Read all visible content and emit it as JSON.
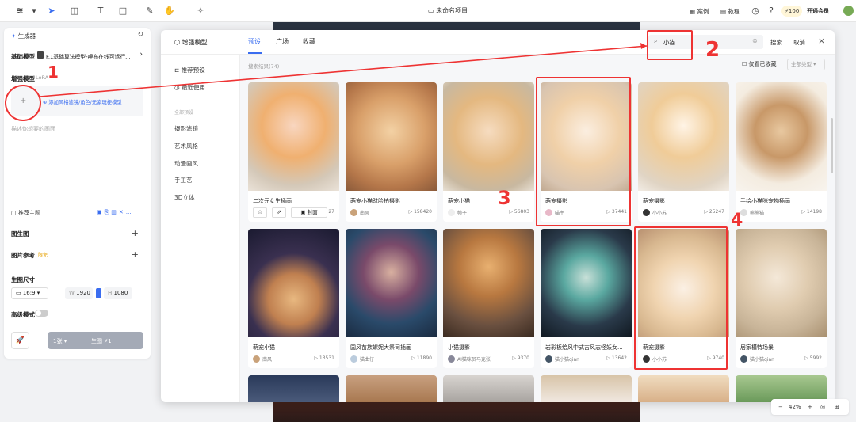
{
  "topbar": {
    "project_title": "未命名项目",
    "right_items": [
      "案例",
      "教程"
    ],
    "credits": "100",
    "member_btn": "开通会员"
  },
  "left_panel": {
    "title": "生成器",
    "base_model_label": "基础模型",
    "base_model_value": "F.1基础算法模型-哩布在线可运行...",
    "enhance_label": "增强模型",
    "enhance_type": "LoRA",
    "add_lora_hint": "添加风格滤镜/角色/元素玩梗模型",
    "prompt_placeholder": "描述你想要的画面",
    "recommend_label": "推荐主题",
    "gen_img_label": "图生图",
    "ref_label": "图片参考",
    "ref_badge": "限免",
    "size_label": "生图尺寸",
    "ratio": "16:9",
    "w_label": "W",
    "w_value": "1920",
    "h_label": "H",
    "h_value": "1080",
    "hd_label": "高级模式",
    "count_btn": "1张",
    "gen_btn": "生图",
    "gen_cost": "1"
  },
  "modal": {
    "title": "增强模型",
    "tabs": [
      "预设",
      "广场",
      "收藏"
    ],
    "active_tab": 0,
    "search_value": "小猫",
    "search_btn": "搜索",
    "cancel_btn": "取消",
    "result_count": "搜索结果(74)",
    "only_fav": "仅看已收藏",
    "all_types": "全部类型",
    "side_top": [
      "推荐预设",
      "最近使用"
    ],
    "side_section": "全部预设",
    "side_cats": [
      "摄影滤镜",
      "艺术风格",
      "动漫画风",
      "手工艺",
      "3D立体"
    ]
  },
  "cards_row1": [
    {
      "title": "二次元女生插画",
      "author": "",
      "plays": "27"
    },
    {
      "title": "萌宠小猫怼脸拍摄影",
      "author": "南风",
      "plays": "158420"
    },
    {
      "title": "萌宠小猫",
      "author": "帧子",
      "plays": "56803"
    },
    {
      "title": "萌宠摄影",
      "author": "喵主",
      "plays": "37441"
    },
    {
      "title": "萌宠摄影",
      "author": "小小苏",
      "plays": "25247"
    },
    {
      "title": "手绘小猫咪宠物插画",
      "author": "熊熊猫",
      "plays": "14198"
    }
  ],
  "cards_row2": [
    {
      "title": "萌宠小猫",
      "author": "南风",
      "plays": "13531"
    },
    {
      "title": "国风苗族螺妮大祭司插画",
      "author": "猫曲仔",
      "plays": "11890"
    },
    {
      "title": "小猫摄影",
      "author": "AI猫咪员马克张",
      "plays": "9370"
    },
    {
      "title": "岩彩板绘风中式古风志怪妖女...",
      "author": "猫小猫qian",
      "plays": "13642"
    },
    {
      "title": "萌宠摄影",
      "author": "小小苏",
      "plays": "9740"
    },
    {
      "title": "居家模特场景",
      "author": "猫小猫qian",
      "plays": "5992"
    }
  ],
  "card1_actions": {
    "cover": "封面"
  },
  "zoom": "42%",
  "annotations": [
    "1",
    "2",
    "3",
    "4"
  ]
}
